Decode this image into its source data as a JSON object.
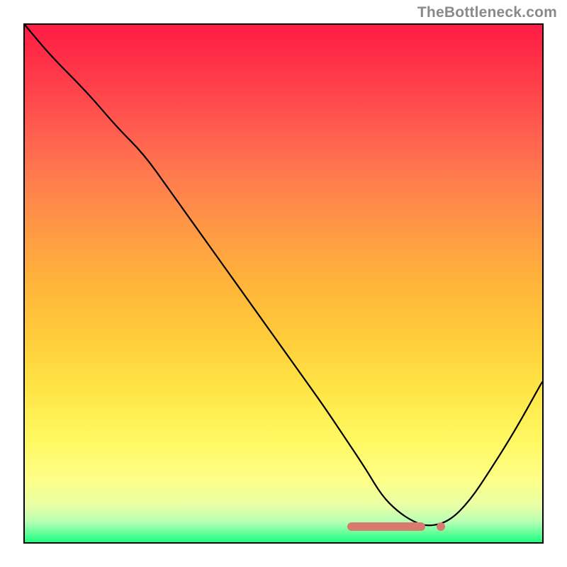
{
  "watermark": "TheBottleneck.com",
  "chart_data": {
    "type": "line",
    "title": "",
    "xlabel": "",
    "ylabel": "",
    "ylim": [
      0,
      100
    ],
    "x": [
      0,
      5,
      12,
      18,
      23,
      28,
      33,
      38,
      43,
      48,
      53,
      58,
      62,
      66,
      69,
      72,
      75,
      78,
      82,
      86,
      90,
      95,
      100
    ],
    "values": [
      100,
      94,
      87,
      80,
      75,
      68,
      61,
      54,
      47,
      40,
      33,
      26,
      20,
      14,
      9,
      6,
      4,
      3,
      4,
      8,
      14,
      22,
      31
    ],
    "annotations": [
      {
        "kind": "marker-band",
        "x_start": 62,
        "x_end": 77,
        "y": 3
      },
      {
        "kind": "marker-dot",
        "x": 80,
        "y": 3
      }
    ],
    "background": {
      "style": "vertical-gradient",
      "stops": [
        {
          "pos": 0,
          "color": "#ff1c44"
        },
        {
          "pos": 50,
          "color": "#ffb43a"
        },
        {
          "pos": 88,
          "color": "#fdff88"
        },
        {
          "pos": 100,
          "color": "#1cff80"
        }
      ]
    }
  }
}
